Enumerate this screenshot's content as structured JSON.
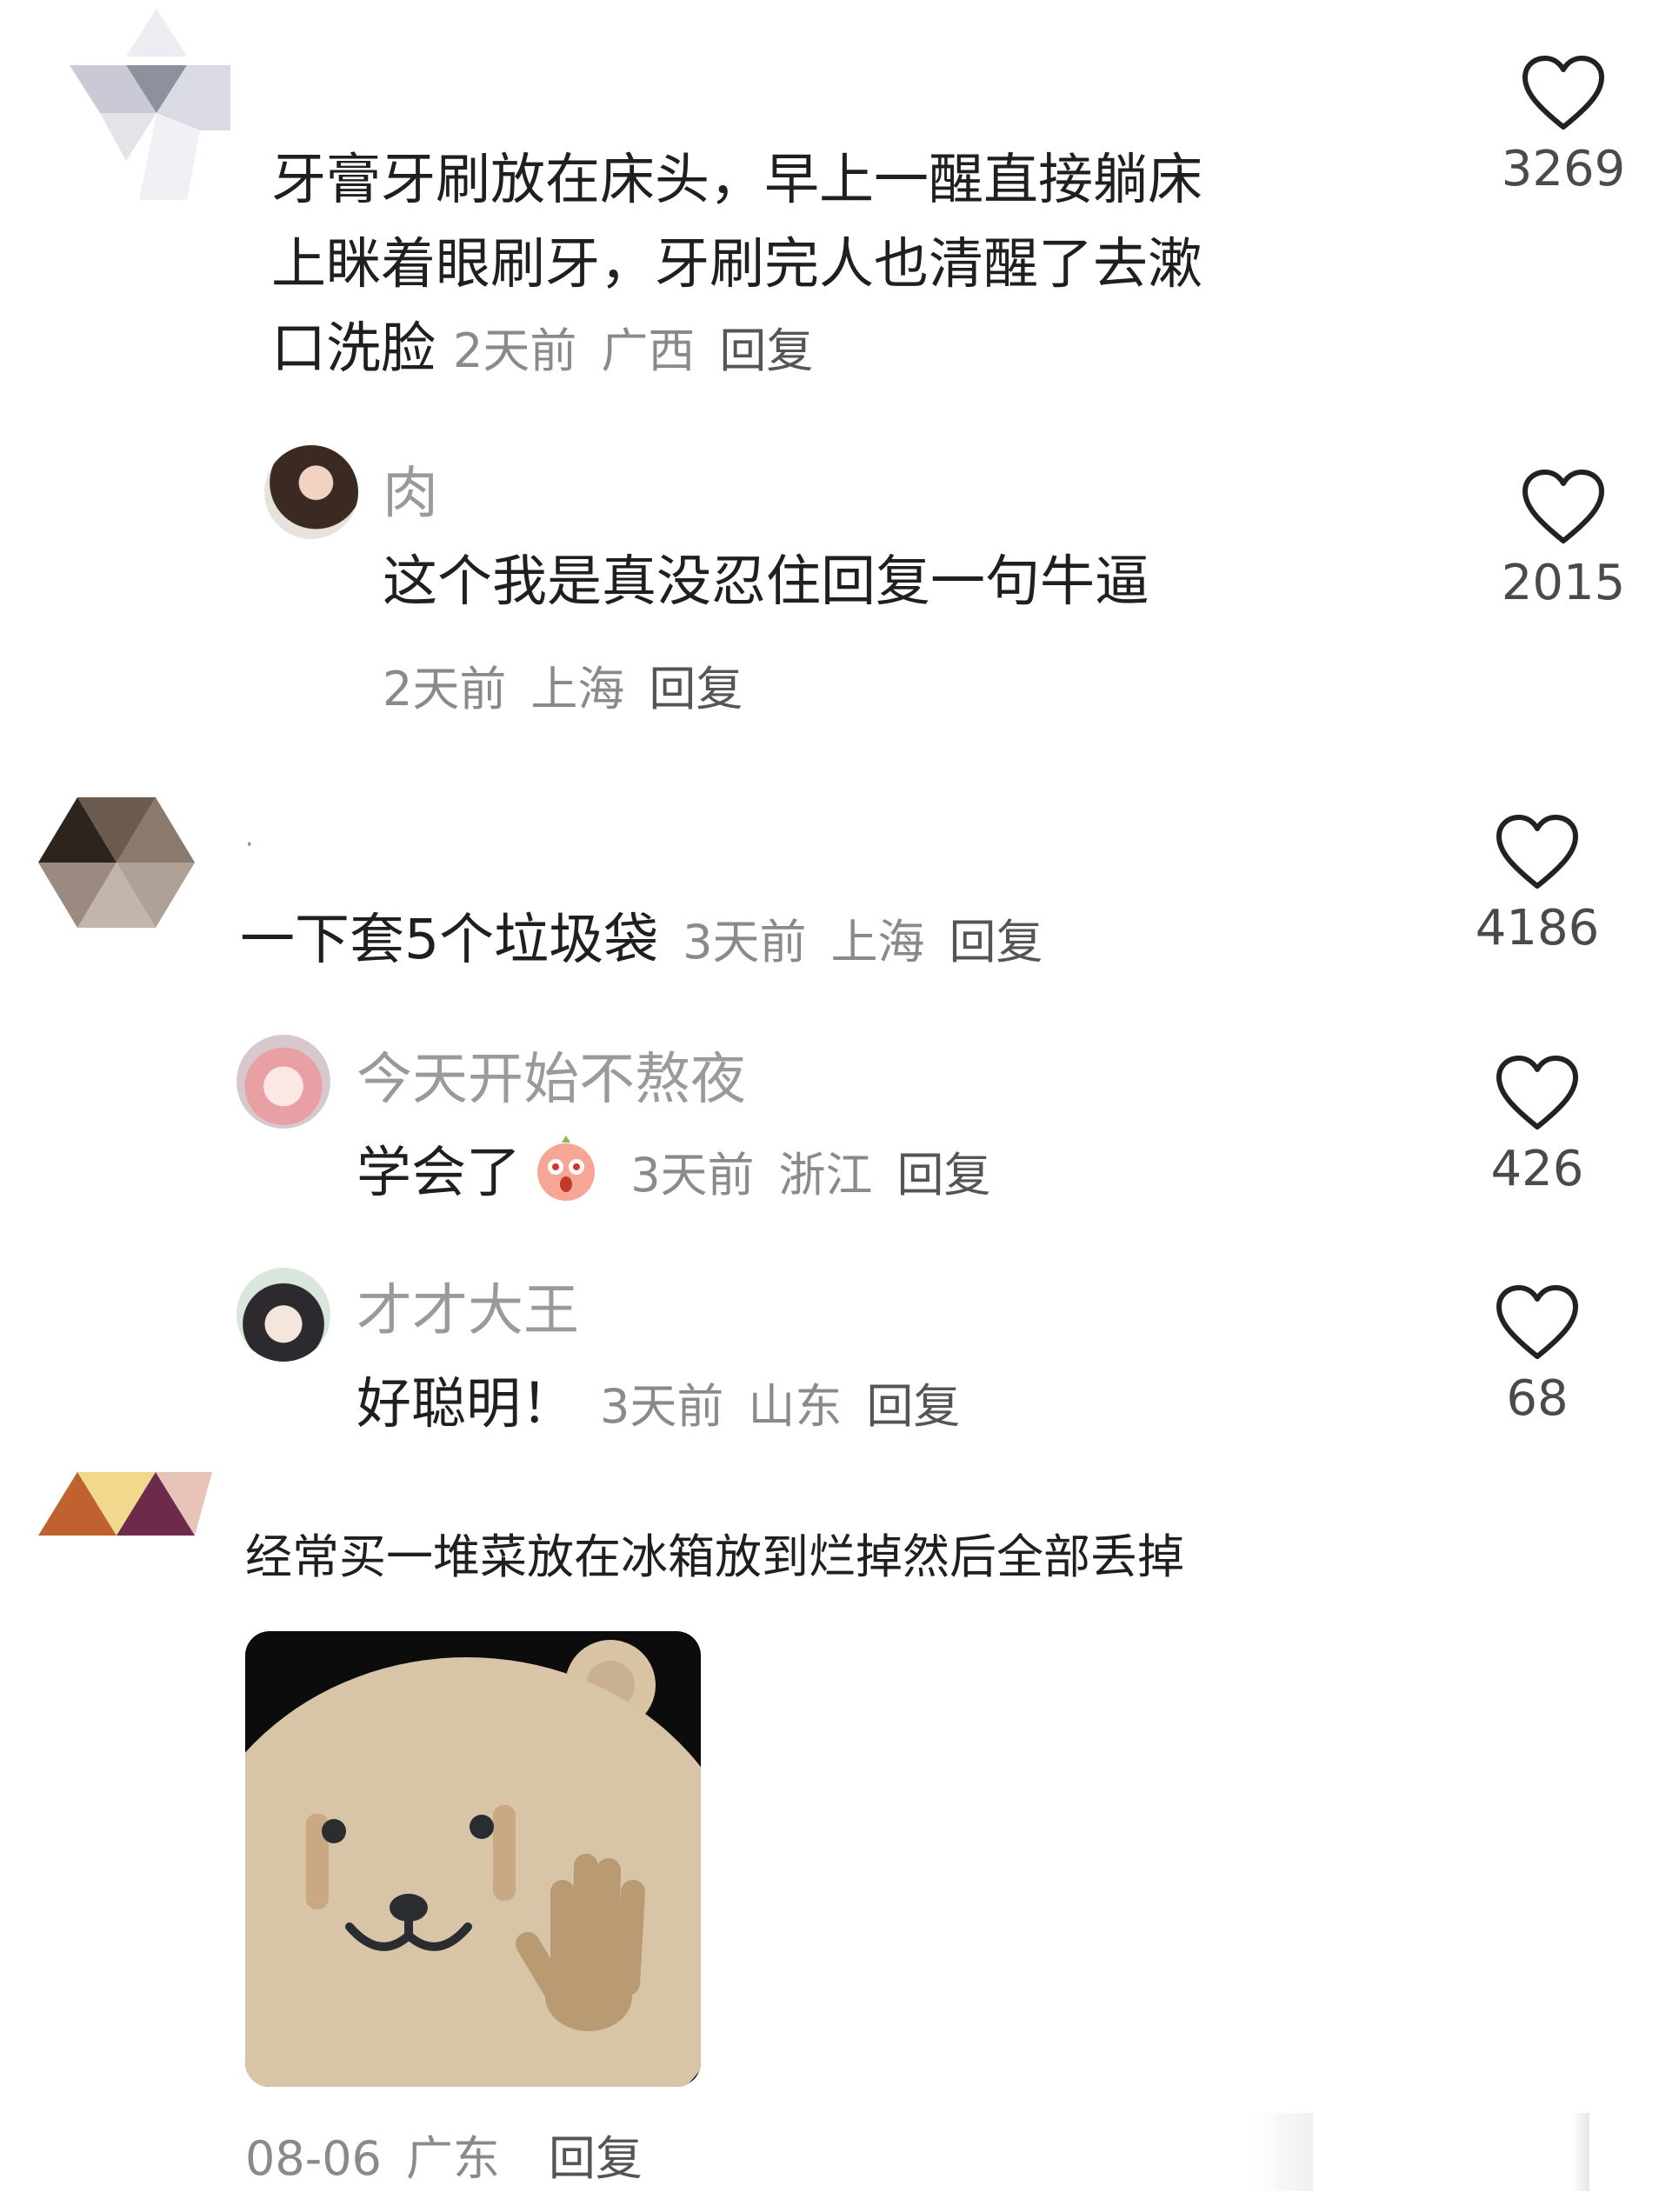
{
  "comments": [
    {
      "text": "牙膏牙刷放在床头，早上一醒直接躺床上眯着眼刷牙，牙刷完人也清醒了去漱口洗脸",
      "line1": "牙膏牙刷放在床头，早上一醒直接躺床",
      "line2": "上眯着眼刷牙，牙刷完人也清醒了去漱",
      "line3": "口洗脸",
      "time": "2天前",
      "location": "广西",
      "reply_label": "回复",
      "likes": "3269",
      "replies": [
        {
          "nickname": "肉",
          "text": "这个我是真没忍住回复一句牛逼",
          "time": "2天前",
          "location": "上海",
          "reply_label": "回复",
          "likes": "2015"
        }
      ]
    },
    {
      "nickname": "·",
      "text": "一下套5个垃圾袋",
      "time": "3天前",
      "location": "上海",
      "reply_label": "回复",
      "likes": "4186",
      "replies": [
        {
          "nickname": "今天开始不熬夜",
          "text": "学会了",
          "emoji": "surprised-face-emoji",
          "time": "3天前",
          "location": "浙江",
          "reply_label": "回复",
          "likes": "426"
        },
        {
          "nickname": "才才大王",
          "text": "好聪明！",
          "time": "3天前",
          "location": "山东",
          "reply_label": "回复",
          "likes": "68"
        }
      ]
    },
    {
      "text": "经常买一堆菜放在冰箱放到烂掉然后全部丢掉",
      "image": "bear-plush-photo",
      "time": "08-06",
      "location": "广东",
      "reply_label": "回复"
    }
  ],
  "colors": {
    "text_primary": "#1f1f1f",
    "text_meta": "#8a8a8a",
    "nickname": "#9a9a9a",
    "like_icon": "#222222"
  }
}
